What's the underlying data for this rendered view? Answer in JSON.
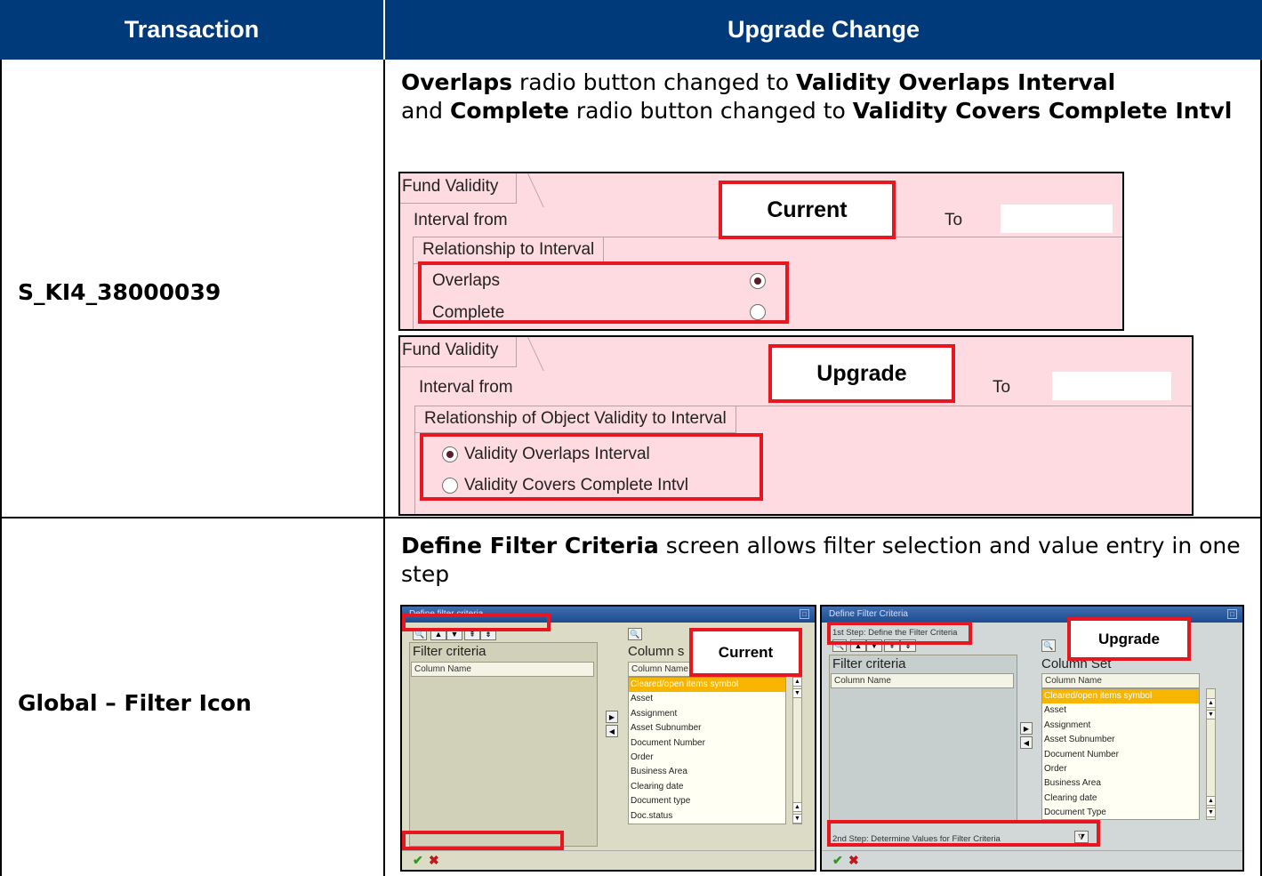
{
  "table": {
    "headers": [
      "Transaction",
      "Upgrade Change"
    ],
    "rows": [
      {
        "transaction": "S_KI4_38000039",
        "change": {
          "parts": [
            "Overlaps",
            " radio button changed to ",
            "Validity Overlaps Interval",
            " and ",
            "Complete",
            " radio button changed to ",
            "Validity Covers Complete Intvl"
          ]
        },
        "current_panel": {
          "tab": "Fund Validity",
          "interval_from": "Interval from",
          "to": "To",
          "group": "Relationship to Interval",
          "options": [
            {
              "label": "Overlaps",
              "selected": true
            },
            {
              "label": "Complete",
              "selected": false
            }
          ],
          "callout": "Current"
        },
        "upgrade_panel": {
          "tab": "Fund Validity",
          "interval_from": "Interval from",
          "to": "To",
          "group": "Relationship of Object Validity to Interval",
          "options": [
            {
              "label": "Validity Overlaps Interval",
              "selected": true
            },
            {
              "label": "Validity Covers Complete Intvl",
              "selected": false
            }
          ],
          "callout": "Upgrade"
        }
      },
      {
        "transaction": "Global – Filter Icon",
        "change": {
          "parts": [
            "Define Filter Criteria",
            " screen allows filter selection and value entry in one step"
          ]
        },
        "current_screen": {
          "title": "Define filter criteria",
          "filter_title": "Filter criteria",
          "filter_col": "Column Name",
          "column_set_title": "Column s",
          "column_set_col": "Column Name",
          "items": [
            "Cleared/open items symbol",
            "Asset",
            "Assignment",
            "Asset Subnumber",
            "Document Number",
            "Order",
            "Business Area",
            "Clearing date",
            "Document type",
            "Doc.status"
          ],
          "callout": "Current"
        },
        "upgrade_screen": {
          "title": "Define Filter Criteria",
          "step1": "1st Step: Define the Filter Criteria",
          "filter_title": "Filter criteria",
          "filter_col": "Column Name",
          "column_set_title": "Column Set",
          "column_set_col": "Column Name",
          "items": [
            "Cleared/open items symbol",
            "Asset",
            "Assignment",
            "Asset Subnumber",
            "Document Number",
            "Order",
            "Business Area",
            "Clearing date",
            "Document Type"
          ],
          "step2": "2nd Step: Determine Values for Filter Criteria",
          "callout": "Upgrade"
        }
      }
    ]
  },
  "colors": {
    "header_bg": "#003a7a",
    "highlight_red": "#e8161e",
    "panel_pink": "#fedbe1",
    "selected_row": "#f7b500"
  }
}
